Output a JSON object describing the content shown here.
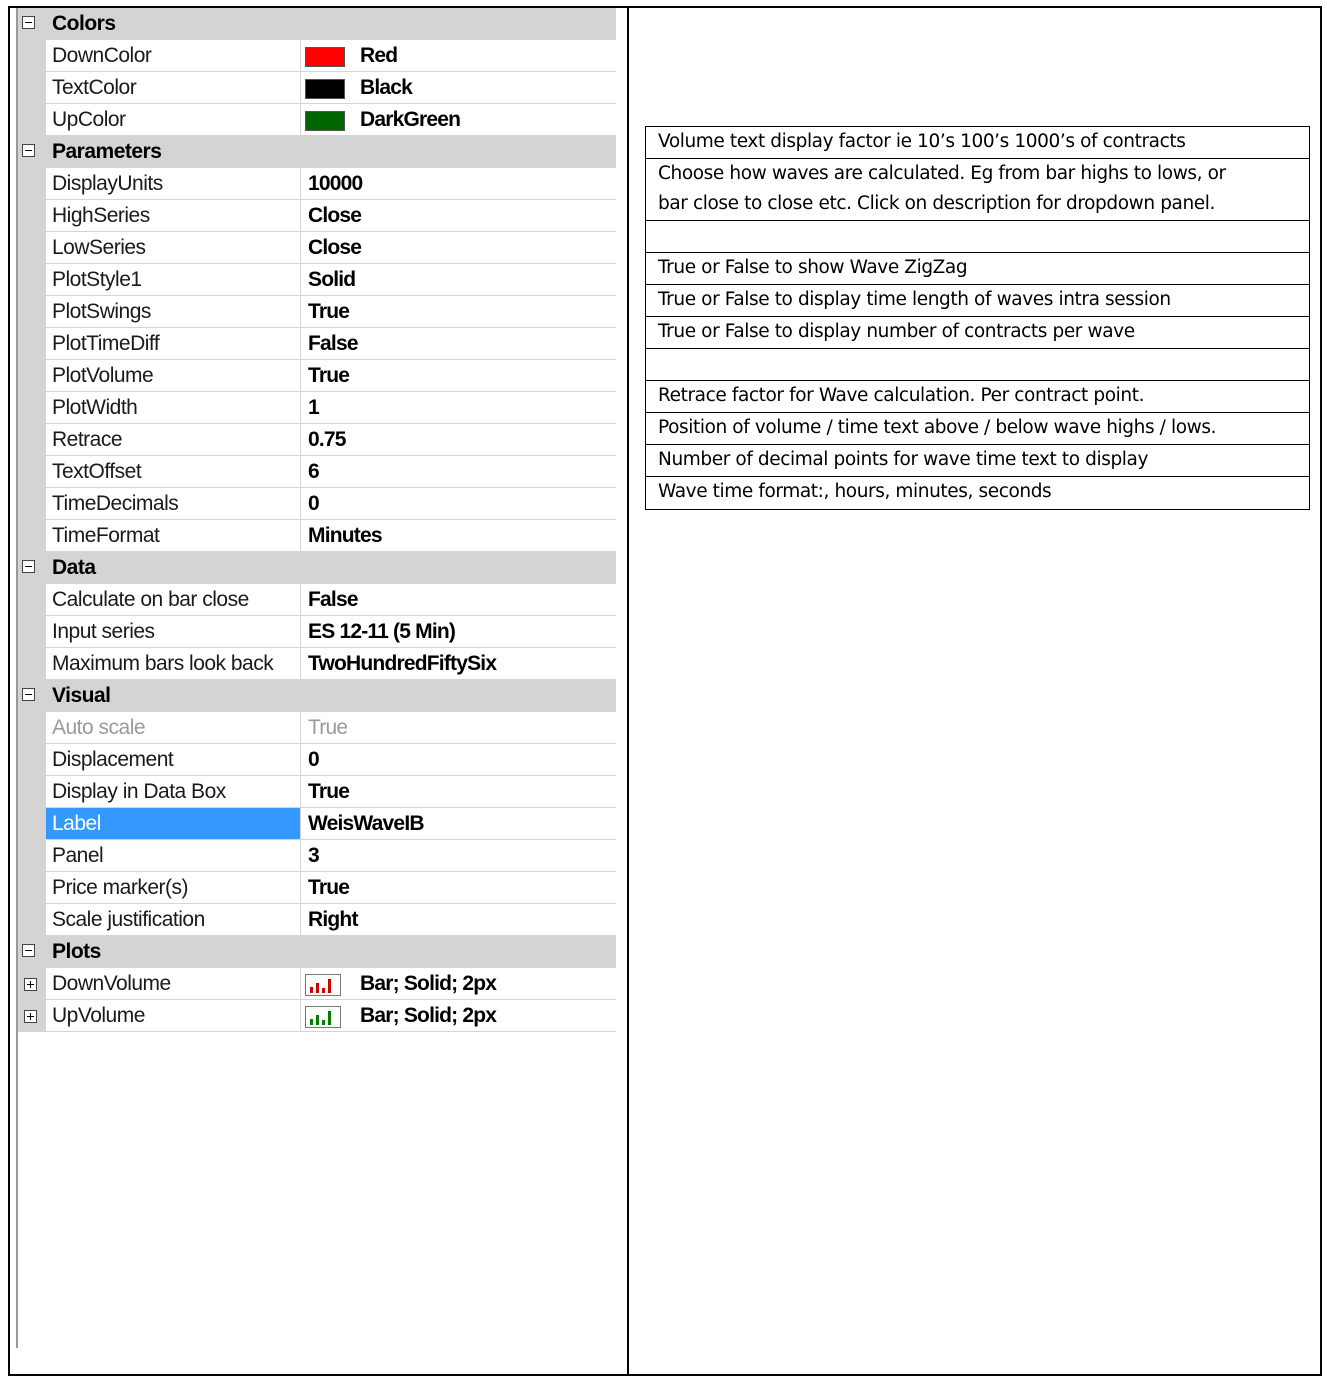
{
  "property_grid": {
    "categories": [
      {
        "label": "Colors",
        "rows": [
          {
            "name": "DownColor",
            "value": "Red",
            "swatch": "#ff0000"
          },
          {
            "name": "TextColor",
            "value": "Black",
            "swatch": "#000000"
          },
          {
            "name": "UpColor",
            "value": "DarkGreen",
            "swatch": "#006400"
          }
        ]
      },
      {
        "label": "Parameters",
        "rows": [
          {
            "name": "DisplayUnits",
            "value": "10000"
          },
          {
            "name": "HighSeries",
            "value": "Close"
          },
          {
            "name": "LowSeries",
            "value": "Close"
          },
          {
            "name": "PlotStyle1",
            "value": "Solid"
          },
          {
            "name": "PlotSwings",
            "value": "True"
          },
          {
            "name": "PlotTimeDiff",
            "value": "False"
          },
          {
            "name": "PlotVolume",
            "value": "True"
          },
          {
            "name": "PlotWidth",
            "value": "1"
          },
          {
            "name": "Retrace",
            "value": "0.75"
          },
          {
            "name": "TextOffset",
            "value": "6"
          },
          {
            "name": "TimeDecimals",
            "value": "0"
          },
          {
            "name": "TimeFormat",
            "value": "Minutes"
          }
        ]
      },
      {
        "label": "Data",
        "rows": [
          {
            "name": "Calculate on bar close",
            "value": "False"
          },
          {
            "name": "Input series",
            "value": "ES 12-11 (5 Min)"
          },
          {
            "name": "Maximum bars look back",
            "value": "TwoHundredFiftySix"
          }
        ]
      },
      {
        "label": "Visual",
        "rows": [
          {
            "name": "Auto scale",
            "value": "True",
            "disabled": true
          },
          {
            "name": "Displacement",
            "value": "0"
          },
          {
            "name": "Display in Data Box",
            "value": "True"
          },
          {
            "name": "Label",
            "value": "WeisWaveIB",
            "selected": true
          },
          {
            "name": "Panel",
            "value": "3"
          },
          {
            "name": "Price marker(s)",
            "value": "True"
          },
          {
            "name": "Scale justification",
            "value": "Right"
          }
        ]
      },
      {
        "label": "Plots",
        "rows": [
          {
            "name": "DownVolume",
            "value": "Bar; Solid; 2px",
            "plot_color": "#cc0000",
            "expandable": true
          },
          {
            "name": "UpVolume",
            "value": "Bar; Solid; 2px",
            "plot_color": "#008000",
            "expandable": true
          }
        ]
      }
    ]
  },
  "descriptions": [
    "Volume text display factor ie 10’s 100’s 1000’s of contracts",
    "Choose how waves are calculated. Eg from bar highs to lows, or",
    "bar close to close etc. Click on description for dropdown panel.",
    "",
    "True or False to show Wave ZigZag",
    "True or False to display time length of waves intra session",
    "True or False to display number of contracts per wave",
    "",
    "Retrace factor for Wave calculation. Per contract point.",
    "Position of volume / time text above / below wave highs / lows.",
    "Number of decimal points for wave time text to display",
    "Wave time format:, hours, minutes, seconds"
  ],
  "colors": {
    "category_bg": "#d4d4d4",
    "selection": "#3399ff"
  }
}
